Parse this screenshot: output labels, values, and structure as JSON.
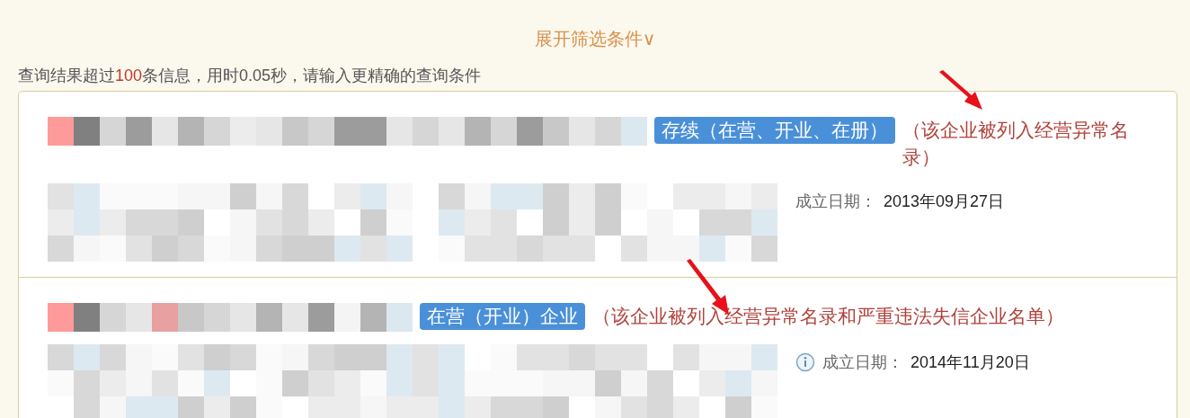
{
  "filter_toggle": {
    "label": "展开筛选条件∨"
  },
  "summary": {
    "before": "查询结果超过",
    "count": "100",
    "after": "条信息，用时0.05秒，请输入更精确的查询条件"
  },
  "results": [
    {
      "status": "存续（在营、开业、在册）",
      "note": "（该企业被列入经营异常名录）",
      "info_icon": false,
      "date_label": "成立日期：",
      "date": "2013年09月27日"
    },
    {
      "status": "在营（开业）企业",
      "note": "（该企业被列入经营异常名录和严重违法失信企业名单）",
      "info_icon": true,
      "date_label": "成立日期：",
      "date": "2014年11月20日"
    }
  ]
}
